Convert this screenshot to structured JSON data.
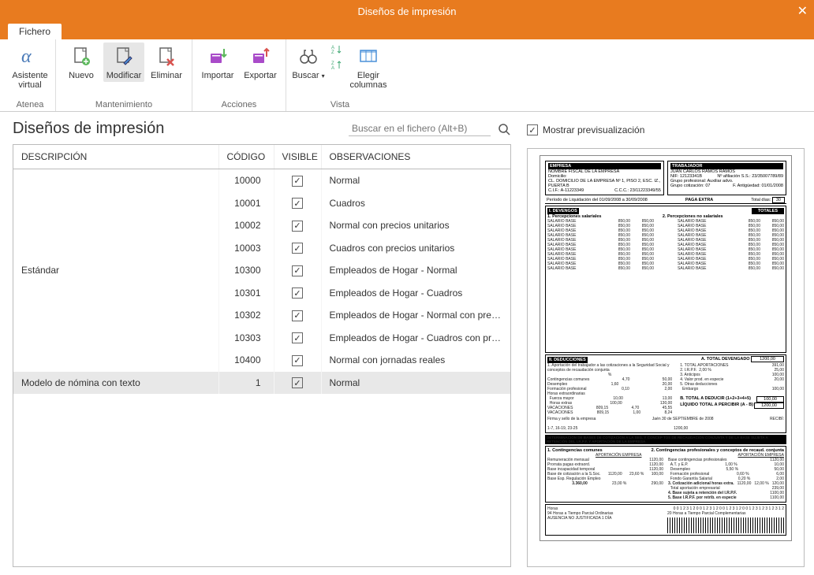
{
  "window": {
    "title": "Diseños de impresión"
  },
  "tabs": {
    "fichero": "Fichero"
  },
  "ribbon": {
    "atenea": {
      "label": "Asistente\nvirtual",
      "group": "Atenea"
    },
    "mantenimiento": {
      "group": "Mantenimiento",
      "nuevo": "Nuevo",
      "modificar": "Modificar",
      "eliminar": "Eliminar"
    },
    "acciones": {
      "group": "Acciones",
      "importar": "Importar",
      "exportar": "Exportar"
    },
    "vista": {
      "group": "Vista",
      "buscar": "Buscar",
      "elegir_cols": "Elegir\ncolumnas"
    }
  },
  "left": {
    "title": "Diseños de impresión",
    "search_placeholder": "Buscar en el fichero (Alt+B)"
  },
  "columns": {
    "desc": "DESCRIPCIÓN",
    "code": "CÓDIGO",
    "visible": "VISIBLE",
    "obs": "OBSERVACIONES"
  },
  "groups": [
    {
      "name": "Estándar",
      "rows": [
        {
          "code": "10000",
          "visible": true,
          "obs": "Normal"
        },
        {
          "code": "10001",
          "visible": true,
          "obs": "Cuadros"
        },
        {
          "code": "10002",
          "visible": true,
          "obs": "Normal con precios unitarios"
        },
        {
          "code": "10003",
          "visible": true,
          "obs": "Cuadros con precios unitarios"
        },
        {
          "code": "10300",
          "visible": true,
          "obs": "Empleados de Hogar - Normal"
        },
        {
          "code": "10301",
          "visible": true,
          "obs": "Empleados de Hogar - Cuadros"
        },
        {
          "code": "10302",
          "visible": true,
          "obs": "Empleados de Hogar - Normal con preci..."
        },
        {
          "code": "10303",
          "visible": true,
          "obs": "Empleados de Hogar - Cuadros con pre..."
        },
        {
          "code": "10400",
          "visible": true,
          "obs": "Normal con jornadas reales"
        }
      ]
    },
    {
      "name": "Modelo de nómina con texto",
      "selected": true,
      "rows": [
        {
          "code": "1",
          "visible": true,
          "obs": "Normal"
        }
      ]
    }
  ],
  "preview": {
    "label": "Mostrar previsualización",
    "checked": true,
    "doc": {
      "empresa_h": "EMPRESA",
      "trabajador_h": "TRABAJADOR",
      "empresa_nombre": "NOMBRE FISCAL DE LA EMPRESA",
      "trabajador_nombre": "JUAN CARLOS RAMOS RAMOS",
      "domicilio_lbl": "Domicilio:",
      "domicilio": "CL. DOMICILIO DE LA EMPRESA Nº 1, PISO 2, ESC. IZ., PUERTA B",
      "nif_lbl": "NIF:",
      "nif": "12123341B",
      "naf_lbl": "Nº afiliación S.S.:",
      "naf": "23/35007789/89",
      "cif_lbl": "C.I.F.:",
      "cif": "A-11223349",
      "ccc_lbl": "C.C.C.:",
      "ccc": "23/11223349/55",
      "grupo_prof_lbl": "Grupo profesional:",
      "grupo_prof": "Auxiliar advo.",
      "grupo_cot_lbl": "Grupo cotización:",
      "grupo_cot": "07",
      "antig_lbl": "F. Antigüedad:",
      "antig": "01/01/2008",
      "periodo_lbl": "Período de Liquidación del",
      "periodo_ini": "01/09/2008",
      "periodo_a": "a",
      "periodo_fin": "30/09/2008",
      "paga": "PAGA EXTRA",
      "dias_lbl": "Total días:",
      "dias": "30",
      "devengos_h": "I. DEVENGOS",
      "totales_h": "TOTALES",
      "percep1": "1. Percepciones salariales",
      "percep2": "2. Percepciones no salariales",
      "salario_base": "SALARIO BASE",
      "v1": "850,00",
      "v2": "850,00",
      "deducciones_h": "II. DEDUCCIONES",
      "total_devengado_lbl": "A. TOTAL DEVENGADO",
      "total_devengado": "1200,00",
      "aport_seg": "1. Aportación del trabajador a las cotizaciones a la Seguridad Social y conceptos de recaudación conjunta",
      "conting_com": "Contingencias comunes",
      "conting_v": "50,00",
      "desempleo": "Desempleo",
      "desempleo_v": "20,00",
      "form_prof": "Formación profesional",
      "form_prof_v": "2,00",
      "horas_extra_lbl": "Horas extraordinarias",
      "fuerza_mayor": "Fuerza mayor",
      "fuerza_mayor_b": "10,00",
      "fuerza_mayor_v": "13,00",
      "horas_extra": "Horas extras",
      "horas_extra_b": "100,00",
      "horas_extra_v": "130,00",
      "vacaciones": "VACACIONES",
      "vac_d1": "809,15",
      "vac_p1": "4,70",
      "vac_v1": "45,55",
      "vac_d2": "809,15",
      "vac_p2": "1,00",
      "vac_v2": "8,24",
      "tot_aport_lbl": "1.   TOTAL APORTACIONES",
      "tot_aport": "391,00",
      "irpf_lbl": "2.   I.R.P.F.",
      "irpf_pc": "2,00  %",
      "irpf_v": "25,00",
      "anticipos_lbl": "3.   Anticipos",
      "anticipos": "100,00",
      "valor_esp_lbl": "4.   Valor prod. en especie",
      "valor_esp": "20,00",
      "otras_lbl": "5.   Otras deducciones",
      "embargo_lbl": "Embargo",
      "embargo": "100,00",
      "tot_deducir_lbl": "B. TOTAL A DEDUCIR (1+2+3+4+5)",
      "tot_deducir": "100,00",
      "liquido_lbl": "LÍQUIDO TOTAL A PERCIBIR (A - B)",
      "liquido": "1200,00",
      "firma": "Firma y sello de la empresa",
      "fecha_loc": "Jaén 30   de SEPTIEMBRE   de   2008",
      "recibir": "RECIBÍ:",
      "rango_dias": "1-7, 16-19, 23-25",
      "rango_v": "1200,00",
      "det_banner": "DETERMINACIÓN DE BASES DE COTIZACIÓN A LA SEG. Y CONCEP TOS DE RECAUDACIÓN CONJUNTA Y DE LA BASE SUJETA A RETENCIÓN DEL I.R.P.F. Y APORTACIÓN DE LA EMPRESA",
      "cc1": "1. Contingencias comunes",
      "cc2": "2. Contingencias profesionales y conceptos de recaud. conjunta",
      "ap_emp": "APORTACIÓN EMPRESA",
      "ap_emp2": "APORTACIÓN EMPRESA",
      "base_cp": "Base contingencias profesionales",
      "base_cp_v": "1120,00",
      "rem_mens": "Remuneración mensual",
      "rem_mens_v": "1120,00",
      "atyep": "A.T. y E.P.",
      "atyep_p": "1,00 %",
      "atyep_v": "10,00",
      "prorrata": "Prorrata pagas extraord.",
      "prorrata_v": "1120,00",
      "desempleo2": "Desempleo",
      "desempleo2_p": "5,50 %",
      "desempleo2_v": "50,00",
      "base_it": "Base incapacidad temporal",
      "base_it_v": "1120,00",
      "form_prof2": "Formación profesional",
      "form_prof2_p": "0,60 %",
      "form_prof2_v": "6,00",
      "base_ss": "Base de cotización a la S.Soc.",
      "base_ss_v": "1120,00",
      "base_ss_p": "23,60 %",
      "base_ss_a": "100,00",
      "fgs": "Fondo Garantía Salarial",
      "fgs_p": "0,20 %",
      "fgs_v": "2,00",
      "base_ere": "Base Esp. Regulación Empleo",
      "cot_adic": "3. Cotización adicional horas extra.",
      "cot_adic_v": "1120,00",
      "cot_adic_p": "12,00 %",
      "cot_adic_a": "120,00",
      "tot_ap_emp": "Total aportación empresarial",
      "tot_ap_emp_v": "239,00",
      "tot_final": "3.360,00",
      "tot_final_p": "23,00 %",
      "tot_final_v": "290,00",
      "base_irpf": "4. Base sujeta a retención del I.R.P.F.",
      "base_irpf_v": "1100,00",
      "base_irpf_esp": "5. Base I.R.P.F. por retrib. en especie",
      "base_irpf_esp_v": "1100,00",
      "horas_row": "Horas",
      "horas_parcial": "94 Horas a Tiempo Parcial Ordinarias",
      "horas_comp": "20 Horas a Tiempo Parcial Complementarias",
      "ausencia": "AUSENCIA NO JUSTIFICADA 1 DÍA"
    }
  }
}
